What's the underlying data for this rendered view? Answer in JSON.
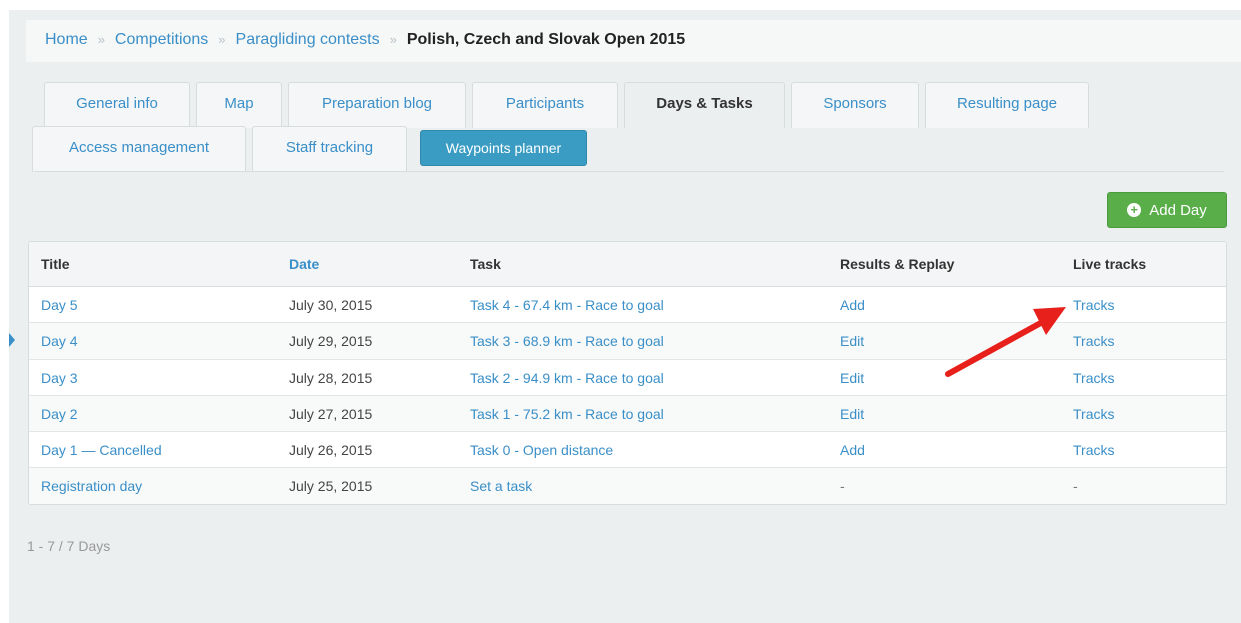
{
  "breadcrumb": {
    "home": "Home",
    "competitions": "Competitions",
    "paragliding": "Paragliding contests",
    "separator": "»",
    "current": "Polish, Czech and Slovak Open 2015"
  },
  "tabs": {
    "general_info": "General info",
    "map": "Map",
    "preparation_blog": "Preparation blog",
    "participants": "Participants",
    "days_tasks": "Days & Tasks",
    "sponsors": "Sponsors",
    "resulting_page": "Resulting page",
    "access_management": "Access management",
    "staff_tracking": "Staff tracking",
    "waypoints_planner": "Waypoints planner"
  },
  "actions": {
    "add_day": "Add Day",
    "add_day_icon": "plus-circle-icon"
  },
  "table": {
    "headers": [
      "Title",
      "Date",
      "Task",
      "Results & Replay",
      "Live tracks"
    ],
    "rows": [
      {
        "title": "Day 5",
        "date": "July 30, 2015",
        "task": "Task 4 - 67.4 km - Race to goal",
        "results": "Add",
        "live": "Tracks"
      },
      {
        "title": "Day 4",
        "date": "July 29, 2015",
        "task": "Task 3 - 68.9 km - Race to goal",
        "results": "Edit",
        "live": "Tracks"
      },
      {
        "title": "Day 3",
        "date": "July 28, 2015",
        "task": "Task 2 - 94.9 km - Race to goal",
        "results": "Edit",
        "live": "Tracks"
      },
      {
        "title": "Day 2",
        "date": "July 27, 2015",
        "task": "Task 1 - 75.2 km - Race to goal",
        "results": "Edit",
        "live": "Tracks"
      },
      {
        "title": "Day 1 — Cancelled",
        "date": "July 26, 2015",
        "task": "Task 0 - Open distance",
        "results": "Add",
        "live": "Tracks"
      },
      {
        "title": "Registration day",
        "date": "July 25, 2015",
        "task": "Set a task",
        "results": "-",
        "live": "-"
      }
    ]
  },
  "pagination": {
    "text": "1 - 7  /  7 Days"
  },
  "colors": {
    "link": "#3a8fc8",
    "accent_button": "#3a9cc3",
    "add_button": "#5aae4a",
    "annotation_arrow": "#e8201b"
  }
}
